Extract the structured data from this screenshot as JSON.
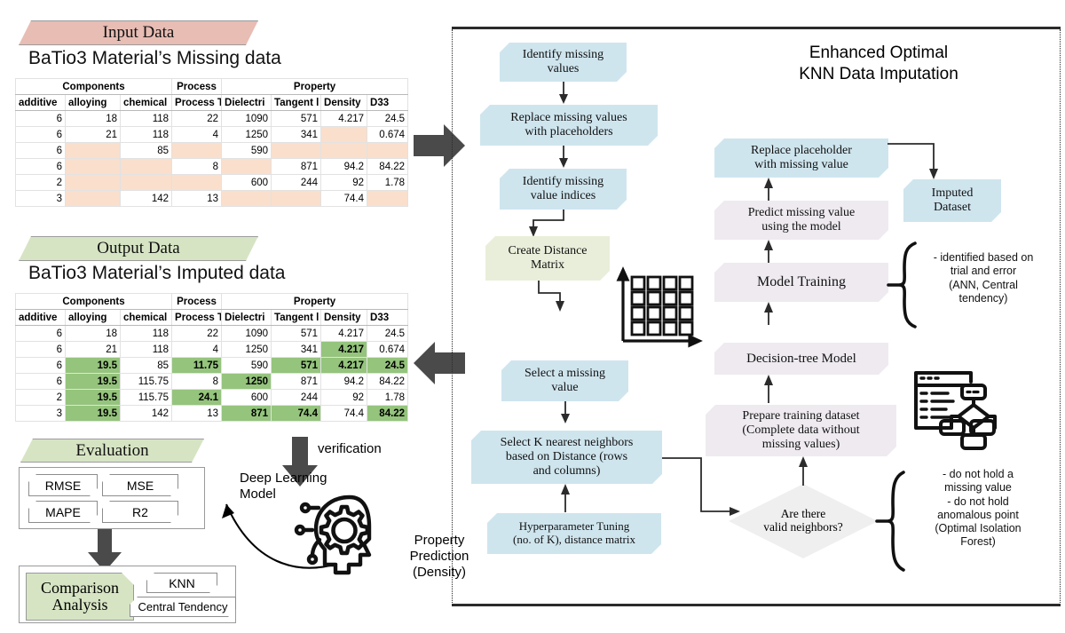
{
  "left": {
    "input_banner": "Input Data",
    "input_title": "BaTio3 Material’s Missing data",
    "output_banner": "Output Data",
    "output_title": "BaTio3 Material’s Imputed data",
    "evaluation_banner": "Evaluation",
    "metrics": [
      "RMSE",
      "MSE",
      "MAPE",
      "R2"
    ],
    "comparison_label": "Comparison\nAnalysis",
    "comparison_methods": [
      "KNN",
      "Central Tendency"
    ],
    "verification_label": "verification",
    "deep_learning_label": "Deep Learning\nModel",
    "property_prediction_label": "Property\nPrediction\n(Density)"
  },
  "table": {
    "group_headers": [
      "Components",
      "Process",
      "Property"
    ],
    "group_spans": [
      3,
      1,
      4
    ],
    "columns": [
      "additive",
      "alloying",
      "chemical ",
      "Process T",
      "Dielectri",
      "Tangent l",
      "Density",
      "D33"
    ],
    "missing_rows": [
      [
        {
          "v": "6"
        },
        {
          "v": "18"
        },
        {
          "v": "118"
        },
        {
          "v": "22"
        },
        {
          "v": "1090"
        },
        {
          "v": "571"
        },
        {
          "v": "4.217"
        },
        {
          "v": "24.5"
        }
      ],
      [
        {
          "v": "6"
        },
        {
          "v": "21"
        },
        {
          "v": "118"
        },
        {
          "v": "4"
        },
        {
          "v": "1250"
        },
        {
          "v": "341"
        },
        {
          "v": "",
          "m": true
        },
        {
          "v": "0.674"
        }
      ],
      [
        {
          "v": "6"
        },
        {
          "v": "",
          "m": true
        },
        {
          "v": "85"
        },
        {
          "v": "",
          "m": true
        },
        {
          "v": "590"
        },
        {
          "v": "",
          "m": true
        },
        {
          "v": "",
          "m": true
        },
        {
          "v": "",
          "m": true
        }
      ],
      [
        {
          "v": "6"
        },
        {
          "v": "",
          "m": true
        },
        {
          "v": "",
          "m": true
        },
        {
          "v": "8"
        },
        {
          "v": "",
          "m": true
        },
        {
          "v": "871"
        },
        {
          "v": "94.2"
        },
        {
          "v": "84.22"
        }
      ],
      [
        {
          "v": "2"
        },
        {
          "v": "",
          "m": true
        },
        {
          "v": "",
          "m": true
        },
        {
          "v": "",
          "m": true
        },
        {
          "v": "600"
        },
        {
          "v": "244"
        },
        {
          "v": "92"
        },
        {
          "v": "1.78"
        }
      ],
      [
        {
          "v": "3"
        },
        {
          "v": "",
          "m": true
        },
        {
          "v": "142"
        },
        {
          "v": "13"
        },
        {
          "v": "",
          "m": true
        },
        {
          "v": "",
          "m": true
        },
        {
          "v": "74.4"
        },
        {
          "v": "",
          "m": true
        }
      ]
    ],
    "imputed_rows": [
      [
        {
          "v": "6"
        },
        {
          "v": "18"
        },
        {
          "v": "118"
        },
        {
          "v": "22"
        },
        {
          "v": "1090"
        },
        {
          "v": "571"
        },
        {
          "v": "4.217"
        },
        {
          "v": "24.5"
        }
      ],
      [
        {
          "v": "6"
        },
        {
          "v": "21"
        },
        {
          "v": "118"
        },
        {
          "v": "4"
        },
        {
          "v": "1250"
        },
        {
          "v": "341"
        },
        {
          "v": "4.217",
          "f": true
        },
        {
          "v": "0.674"
        }
      ],
      [
        {
          "v": "6"
        },
        {
          "v": "19.5",
          "f": true
        },
        {
          "v": "85"
        },
        {
          "v": "11.75",
          "f": true
        },
        {
          "v": "590"
        },
        {
          "v": "571",
          "f": true
        },
        {
          "v": "4.217",
          "f": true
        },
        {
          "v": "24.5",
          "f": true
        }
      ],
      [
        {
          "v": "6"
        },
        {
          "v": "19.5",
          "f": true
        },
        {
          "v": "115.75"
        },
        {
          "v": "8"
        },
        {
          "v": "1250",
          "f": true
        },
        {
          "v": "871"
        },
        {
          "v": "94.2"
        },
        {
          "v": "84.22"
        }
      ],
      [
        {
          "v": "2"
        },
        {
          "v": "19.5",
          "f": true
        },
        {
          "v": "115.75"
        },
        {
          "v": "24.1",
          "f": true
        },
        {
          "v": "600"
        },
        {
          "v": "244"
        },
        {
          "v": "92"
        },
        {
          "v": "1.78"
        }
      ],
      [
        {
          "v": "3"
        },
        {
          "v": "19.5",
          "f": true
        },
        {
          "v": "142"
        },
        {
          "v": "13"
        },
        {
          "v": "871",
          "f": true
        },
        {
          "v": "74.4",
          "f": true
        },
        {
          "v": "74.4"
        },
        {
          "v": "84.22",
          "f": true
        }
      ]
    ]
  },
  "right": {
    "panel_title": "Enhanced Optimal\nKNN Data Imputation",
    "flow_left": [
      "Identify missing\nvalues",
      "Replace missing values\nwith placeholders",
      "Identify missing\nvalue indices",
      "Create Distance\nMatrix",
      "Select a missing\nvalue",
      "Select K nearest neighbors\nbased on Distance (rows\nand columns)",
      "Hyperparameter Tuning\n(no. of K), distance matrix"
    ],
    "flow_right": [
      "Replace placeholder\nwith missing value",
      "Imputed\nDataset",
      "Predict missing value\nusing the model",
      "Model Training",
      "Decision-tree Model",
      "Prepare training dataset\n(Complete data without\nmissing values)"
    ],
    "decision": "Are there\nvalid neighbors?",
    "note_model": "- identified based on\ntrial and error\n(ANN, Central\ntendency)",
    "note_neighbors": "- do not hold a\nmissing value\n   - do not hold\nanomalous point\n(Optimal Isolation\nForest)"
  },
  "colors": {
    "pink_banner": "#e7bdb4",
    "green_banner": "#d6e4c3",
    "missing_cell": "#fadfcc",
    "filled_cell": "#95c47d",
    "node_blue": "#cfe5ee",
    "node_olive": "#e9eeda",
    "node_lavender": "#eeeaf0",
    "arrow_gray": "#4a4a4a"
  }
}
